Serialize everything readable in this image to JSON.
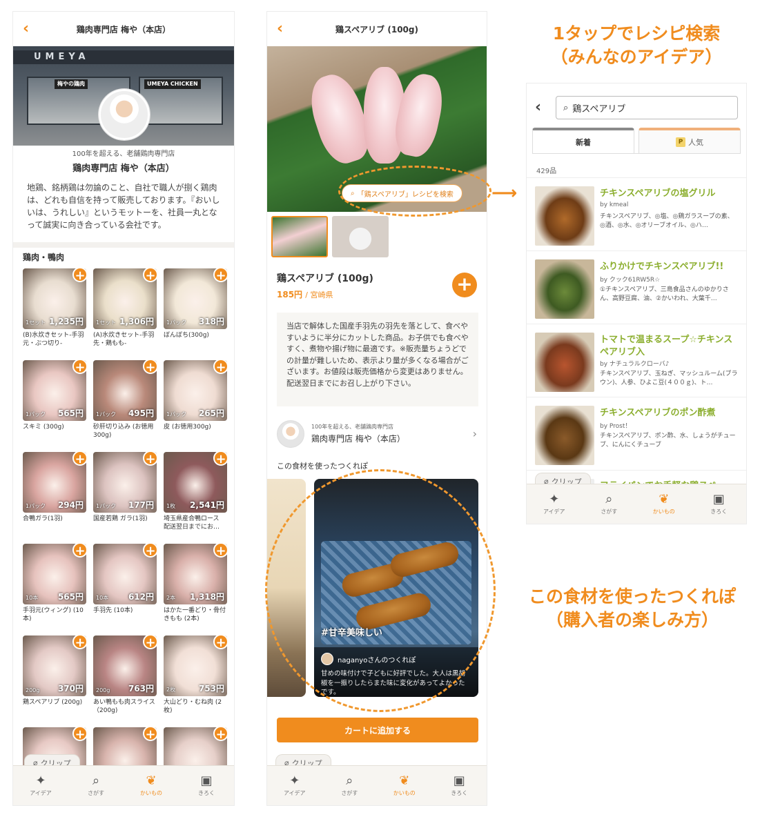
{
  "store_page": {
    "title": "鶏肉専門店 梅や（本店）",
    "storefront_sign": "UMEYA",
    "storefront_label_left": "梅やの鶏肉",
    "storefront_label_right": "UMEYA CHICKEN",
    "subtitle": "100年を超える、老舗鶏肉専門店",
    "name": "鶏肉専門店 梅や（本店）",
    "description": "地鶏、銘柄鶏は勿論のこと、自社で職人が捌く鶏肉は、どれも自信を持って販売しております。『おいしいは、うれしい』というモットーを、社員一丸となって誠実に向き合っている会社です。",
    "section_title": "鶏肉・鴨肉",
    "products": [
      {
        "unit": "1セット",
        "price": "1,235円",
        "name": "(B)水炊きセット-手羽元・ぶつ切り-"
      },
      {
        "unit": "1セット",
        "price": "1,306円",
        "name": "(A)水炊きセット-手羽先・鶏もも-"
      },
      {
        "unit": "1パック",
        "price": "318円",
        "name": "ぼんぼち(300g)"
      },
      {
        "unit": "1パック",
        "price": "565円",
        "name": "スキミ (300g)"
      },
      {
        "unit": "1パック",
        "price": "495円",
        "name": "砂肝切り込み (お徳用300g)"
      },
      {
        "unit": "1パック",
        "price": "265円",
        "name": "皮 (お徳用300g)"
      },
      {
        "unit": "1パック",
        "price": "294円",
        "name": "合鴨ガラ(1羽)"
      },
      {
        "unit": "1パック",
        "price": "177円",
        "name": "国産若鶏 ガラ(1羽)"
      },
      {
        "unit": "1枚",
        "price": "2,541円",
        "name": "埼玉県産合鴨ロース 配送翌日までにお…"
      },
      {
        "unit": "10本",
        "price": "565円",
        "name": "手羽元(ウィング) (10本)"
      },
      {
        "unit": "10本",
        "price": "612円",
        "name": "手羽先 (10本)"
      },
      {
        "unit": "2本",
        "price": "1,318円",
        "name": "はかた一番どり・骨付きもも (2本)"
      },
      {
        "unit": "200g",
        "price": "370円",
        "name": "鶏スペアリブ (200g)"
      },
      {
        "unit": "200g",
        "price": "763円",
        "name": "あい鴨もも肉スライス（200g)"
      },
      {
        "unit": "2枚",
        "price": "753円",
        "name": "大山どり・むね肉 (2枚)"
      },
      {
        "unit": "",
        "price": "",
        "name": ""
      },
      {
        "unit": "",
        "price": "",
        "name": ""
      },
      {
        "unit": "",
        "price": "",
        "name": ""
      }
    ]
  },
  "product_page": {
    "title": "鶏スペアリブ (100g)",
    "search_pill": "「鶏スペアリブ」レシピを検索",
    "name": "鶏スペアリブ (100g)",
    "price": "185円",
    "origin": "宮崎県",
    "description": "当店で解体した国産手羽先の羽先を落として、食べやすいように半分にカットした商品。お子供でも食べやすく、煮物や揚げ物に最適です。※販売量ちょうどでの計量が難しいため、表示より量が多くなる場合がございます。お値段は販売価格から変更はありません。配送翌日までにお召し上がり下さい。",
    "shop_subtitle": "100年を超える、老舗鶏肉専門店",
    "shop_name": "鶏肉専門店 梅や（本店）",
    "tsukurepo_heading": "この食材を使ったつくれぽ",
    "hashtag": "#甘辛美味しい",
    "repo_user": "naganyoさんのつくれぽ",
    "repo_text": "甘めの味付けで子どもに好評でした。大人は黒胡椒を一振りしたらまた味に変化があってよかったです。",
    "cart_button": "カートに追加する"
  },
  "search_page": {
    "query": "鶏スペアリブ",
    "tab_new": "新着",
    "tab_popular": "人気",
    "count": "429品",
    "recipes": [
      {
        "title": "チキンスペアリブの塩グリル",
        "by": "by kmeal",
        "ingredients": "チキンスペアリブ、◎塩、◎鶏ガラスープの素、◎酒、◎水、◎オリーブオイル、◎ハ…"
      },
      {
        "title": "ふりかけでチキンスペアリブ!!",
        "by": "by クック61RW5R☆",
        "ingredients": "①チキンスペアリブ、三島食品さんのゆかりさん、高野豆腐、油、②かいわれ、大葉千…"
      },
      {
        "title": "トマトで温まるスープ☆チキンスペアリブ入",
        "by": "by ナチュラルクローバ♪",
        "ingredients": "チキンスペアリブ、玉ねぎ、マッシュルーム(ブラウン)、人参、ひよこ豆(４００ｇ)、ト…"
      },
      {
        "title": "チキンスペアリブのポン酢煮",
        "by": "by Prost！",
        "ingredients": "チキンスペアリブ、ポン酢、水、しょうがチューブ、にんにくチューブ"
      },
      {
        "title": "フライパンでお手軽な鶏スペ",
        "by": "",
        "ingredients": ""
      }
    ]
  },
  "clip_label": "クリップ",
  "tabbar": {
    "idea": "アイデア",
    "search": "さがす",
    "kaimono": "かいもの",
    "kiroku": "きろく"
  },
  "annotations": {
    "top_line1": "1タップでレシピ検索",
    "top_line2": "（みんなのアイデア）",
    "bottom_line1": "この食材を使ったつくれぽ",
    "bottom_line2": "（購入者の楽しみ方）"
  },
  "colors": {
    "accent": "#f08c1e",
    "recipe_title": "#8bae2e"
  }
}
